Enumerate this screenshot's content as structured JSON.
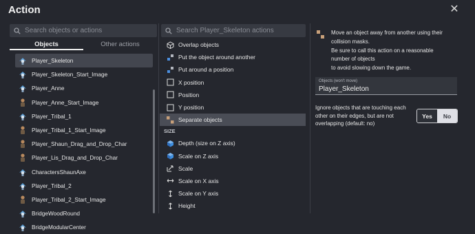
{
  "dialog": {
    "title": "Action",
    "close_icon": "close-icon"
  },
  "objects_panel": {
    "search_placeholder": "Search objects or actions",
    "tabs": [
      {
        "label": "Objects",
        "active": true
      },
      {
        "label": "Other actions",
        "active": false
      }
    ],
    "items": [
      {
        "label": "Player_Skeleton",
        "icon": "skeleton-sprite-icon",
        "selected": true
      },
      {
        "label": "Player_Skeleton_Start_Image",
        "icon": "skeleton-sprite-icon"
      },
      {
        "label": "Player_Anne",
        "icon": "skeleton-sprite-icon"
      },
      {
        "label": "Player_Anne_Start_Image",
        "icon": "character-sprite-icon"
      },
      {
        "label": "Player_Tribal_1",
        "icon": "skeleton-sprite-icon"
      },
      {
        "label": "Player_Tribal_1_Start_Image",
        "icon": "character-sprite-icon"
      },
      {
        "label": "Player_Shaun_Drag_and_Drop_Char",
        "icon": "character-sprite-icon"
      },
      {
        "label": "Player_Lis_Drag_and_Drop_Char",
        "icon": "character-sprite-icon"
      },
      {
        "label": "CharactersShaunAxe",
        "icon": "skeleton-sprite-icon"
      },
      {
        "label": "Player_Tribal_2",
        "icon": "skeleton-sprite-icon"
      },
      {
        "label": "Player_Tribal_2_Start_Image",
        "icon": "character-sprite-icon"
      },
      {
        "label": "BridgeWoodRound",
        "icon": "skeleton-sprite-icon"
      },
      {
        "label": "BridgeModularCenter",
        "icon": "skeleton-sprite-icon"
      }
    ]
  },
  "actions_panel": {
    "search_placeholder": "Search Player_Skeleton actions",
    "items": [
      {
        "label": "Overlap objects",
        "icon": "overlap-icon"
      },
      {
        "label": "Put the object around another",
        "icon": "put-around-icon"
      },
      {
        "label": "Put around a position",
        "icon": "put-around-icon"
      },
      {
        "label": "X position",
        "icon": "position-box-icon"
      },
      {
        "label": "Position",
        "icon": "position-box-icon"
      },
      {
        "label": "Y position",
        "icon": "position-box-icon"
      },
      {
        "label": "Separate objects",
        "icon": "separate-objects-icon",
        "selected": true
      }
    ],
    "section_size": "SIZE",
    "size_items": [
      {
        "label": "Depth (size on Z axis)",
        "icon": "cube-icon"
      },
      {
        "label": "Scale on Z axis",
        "icon": "cube-icon"
      },
      {
        "label": "Scale",
        "icon": "scale-icon"
      },
      {
        "label": "Scale on X axis",
        "icon": "horizontal-arrows-icon"
      },
      {
        "label": "Scale on Y axis",
        "icon": "vertical-arrows-icon"
      },
      {
        "label": "Height",
        "icon": "vertical-arrows-icon"
      }
    ]
  },
  "details_panel": {
    "description_lines": [
      "Move an object away from another using their",
      "collision masks.",
      "Be sure to call this action on a reasonable",
      "number of objects",
      "to avoid slowing down the game."
    ],
    "field": {
      "label": "Objects (won't move)",
      "value": "Player_Skeleton"
    },
    "toggle": {
      "label": "Ignore objects that are touching each other on their edges, but are not overlapping (default: no)",
      "yes_label": "Yes",
      "no_label": "No",
      "selected": "No"
    }
  },
  "colors": {
    "background": "#25272e",
    "input_bg": "#373a42",
    "selected_row": "#43464f",
    "text": "#e6e6e6",
    "cube_blue": "#3d8fe0"
  }
}
